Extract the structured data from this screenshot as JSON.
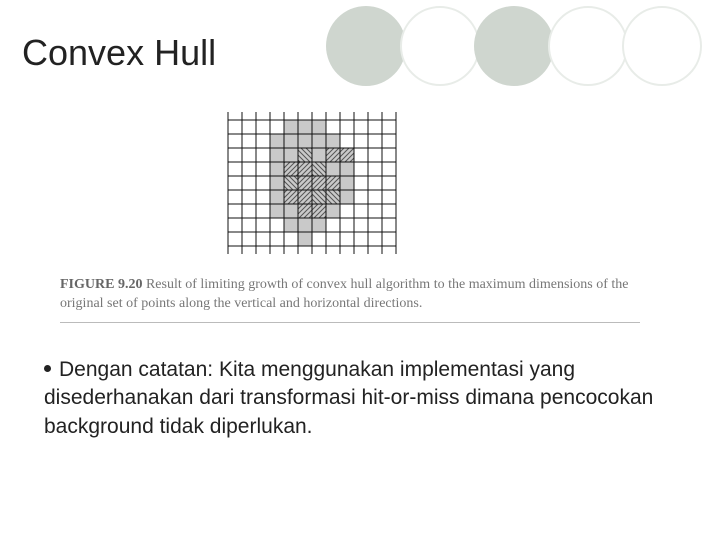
{
  "title": "Convex Hull",
  "figure": {
    "label": "FIGURE 9.20",
    "caption": "Result of limiting growth of convex hull algorithm to the maximum dimensions of the original set of points along the vertical and horizontal directions."
  },
  "bullet_text": "Dengan catatan: Kita menggunakan implementasi yang disederhanakan dari transformasi hit-or-miss dimana pencocokan background tidak diperlukan."
}
